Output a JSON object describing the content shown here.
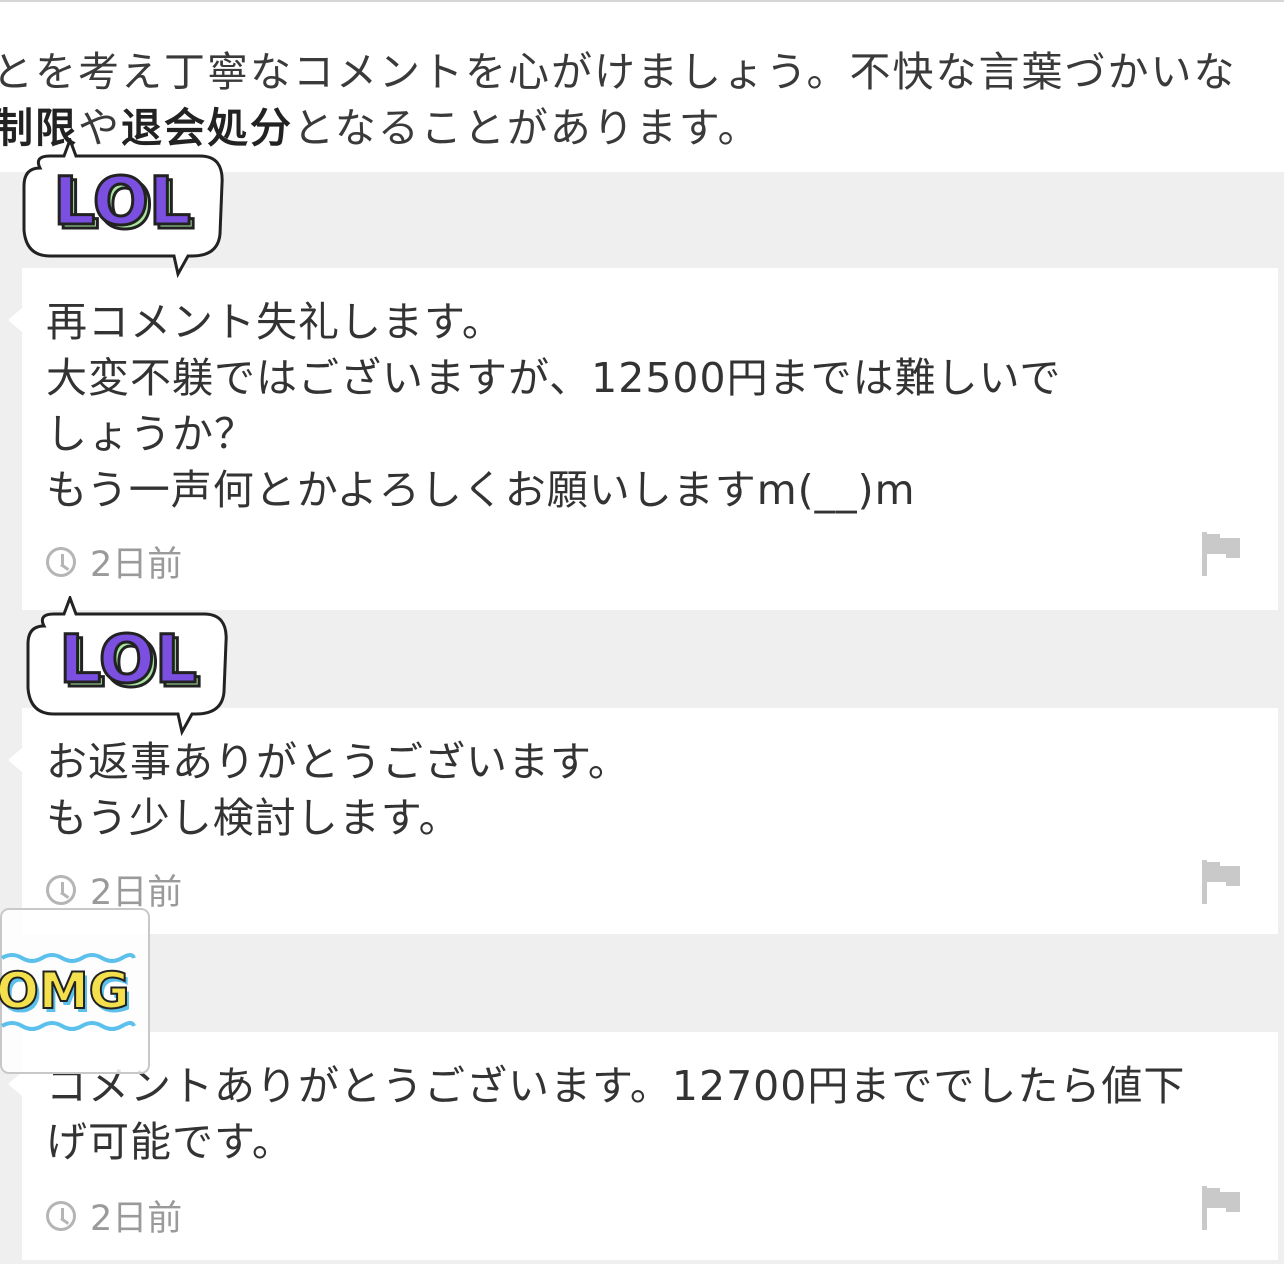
{
  "notice": {
    "line1": "とを考え丁寧なコメントを心がけましょう。不快な言葉づかいな",
    "line2_a": "制限",
    "line2_b": "や",
    "line2_c": "退会処分",
    "line2_d": "となることがあります。"
  },
  "stickers": [
    {
      "text": "LOL",
      "icon": "lol-sticker",
      "color": "#7b4fe0",
      "shadow": "#a8e6a0"
    },
    {
      "text": "LOL",
      "icon": "lol-sticker",
      "color": "#7b4fe0",
      "shadow": "#a8e6a0"
    },
    {
      "text": "OMG",
      "icon": "omg-sticker",
      "color": "#f4e04d",
      "shadow": "#5bc0eb"
    }
  ],
  "comments": [
    {
      "text": "再コメント失礼します。\n大変不躾ではございますが、12500円までは難しいで\nしょうか？\nもう一声何とかよろしくお願いしますm(__)m",
      "time": "2日前"
    },
    {
      "text": "お返事ありがとうございます。\nもう少し検討します。",
      "time": "2日前"
    },
    {
      "text": "コメントありがとうございます。12700円まででしたら値下\nげ可能です。",
      "time": "2日前"
    }
  ],
  "colors": {
    "background": "#efefef",
    "card": "#ffffff",
    "meta": "#9a9a9a"
  }
}
